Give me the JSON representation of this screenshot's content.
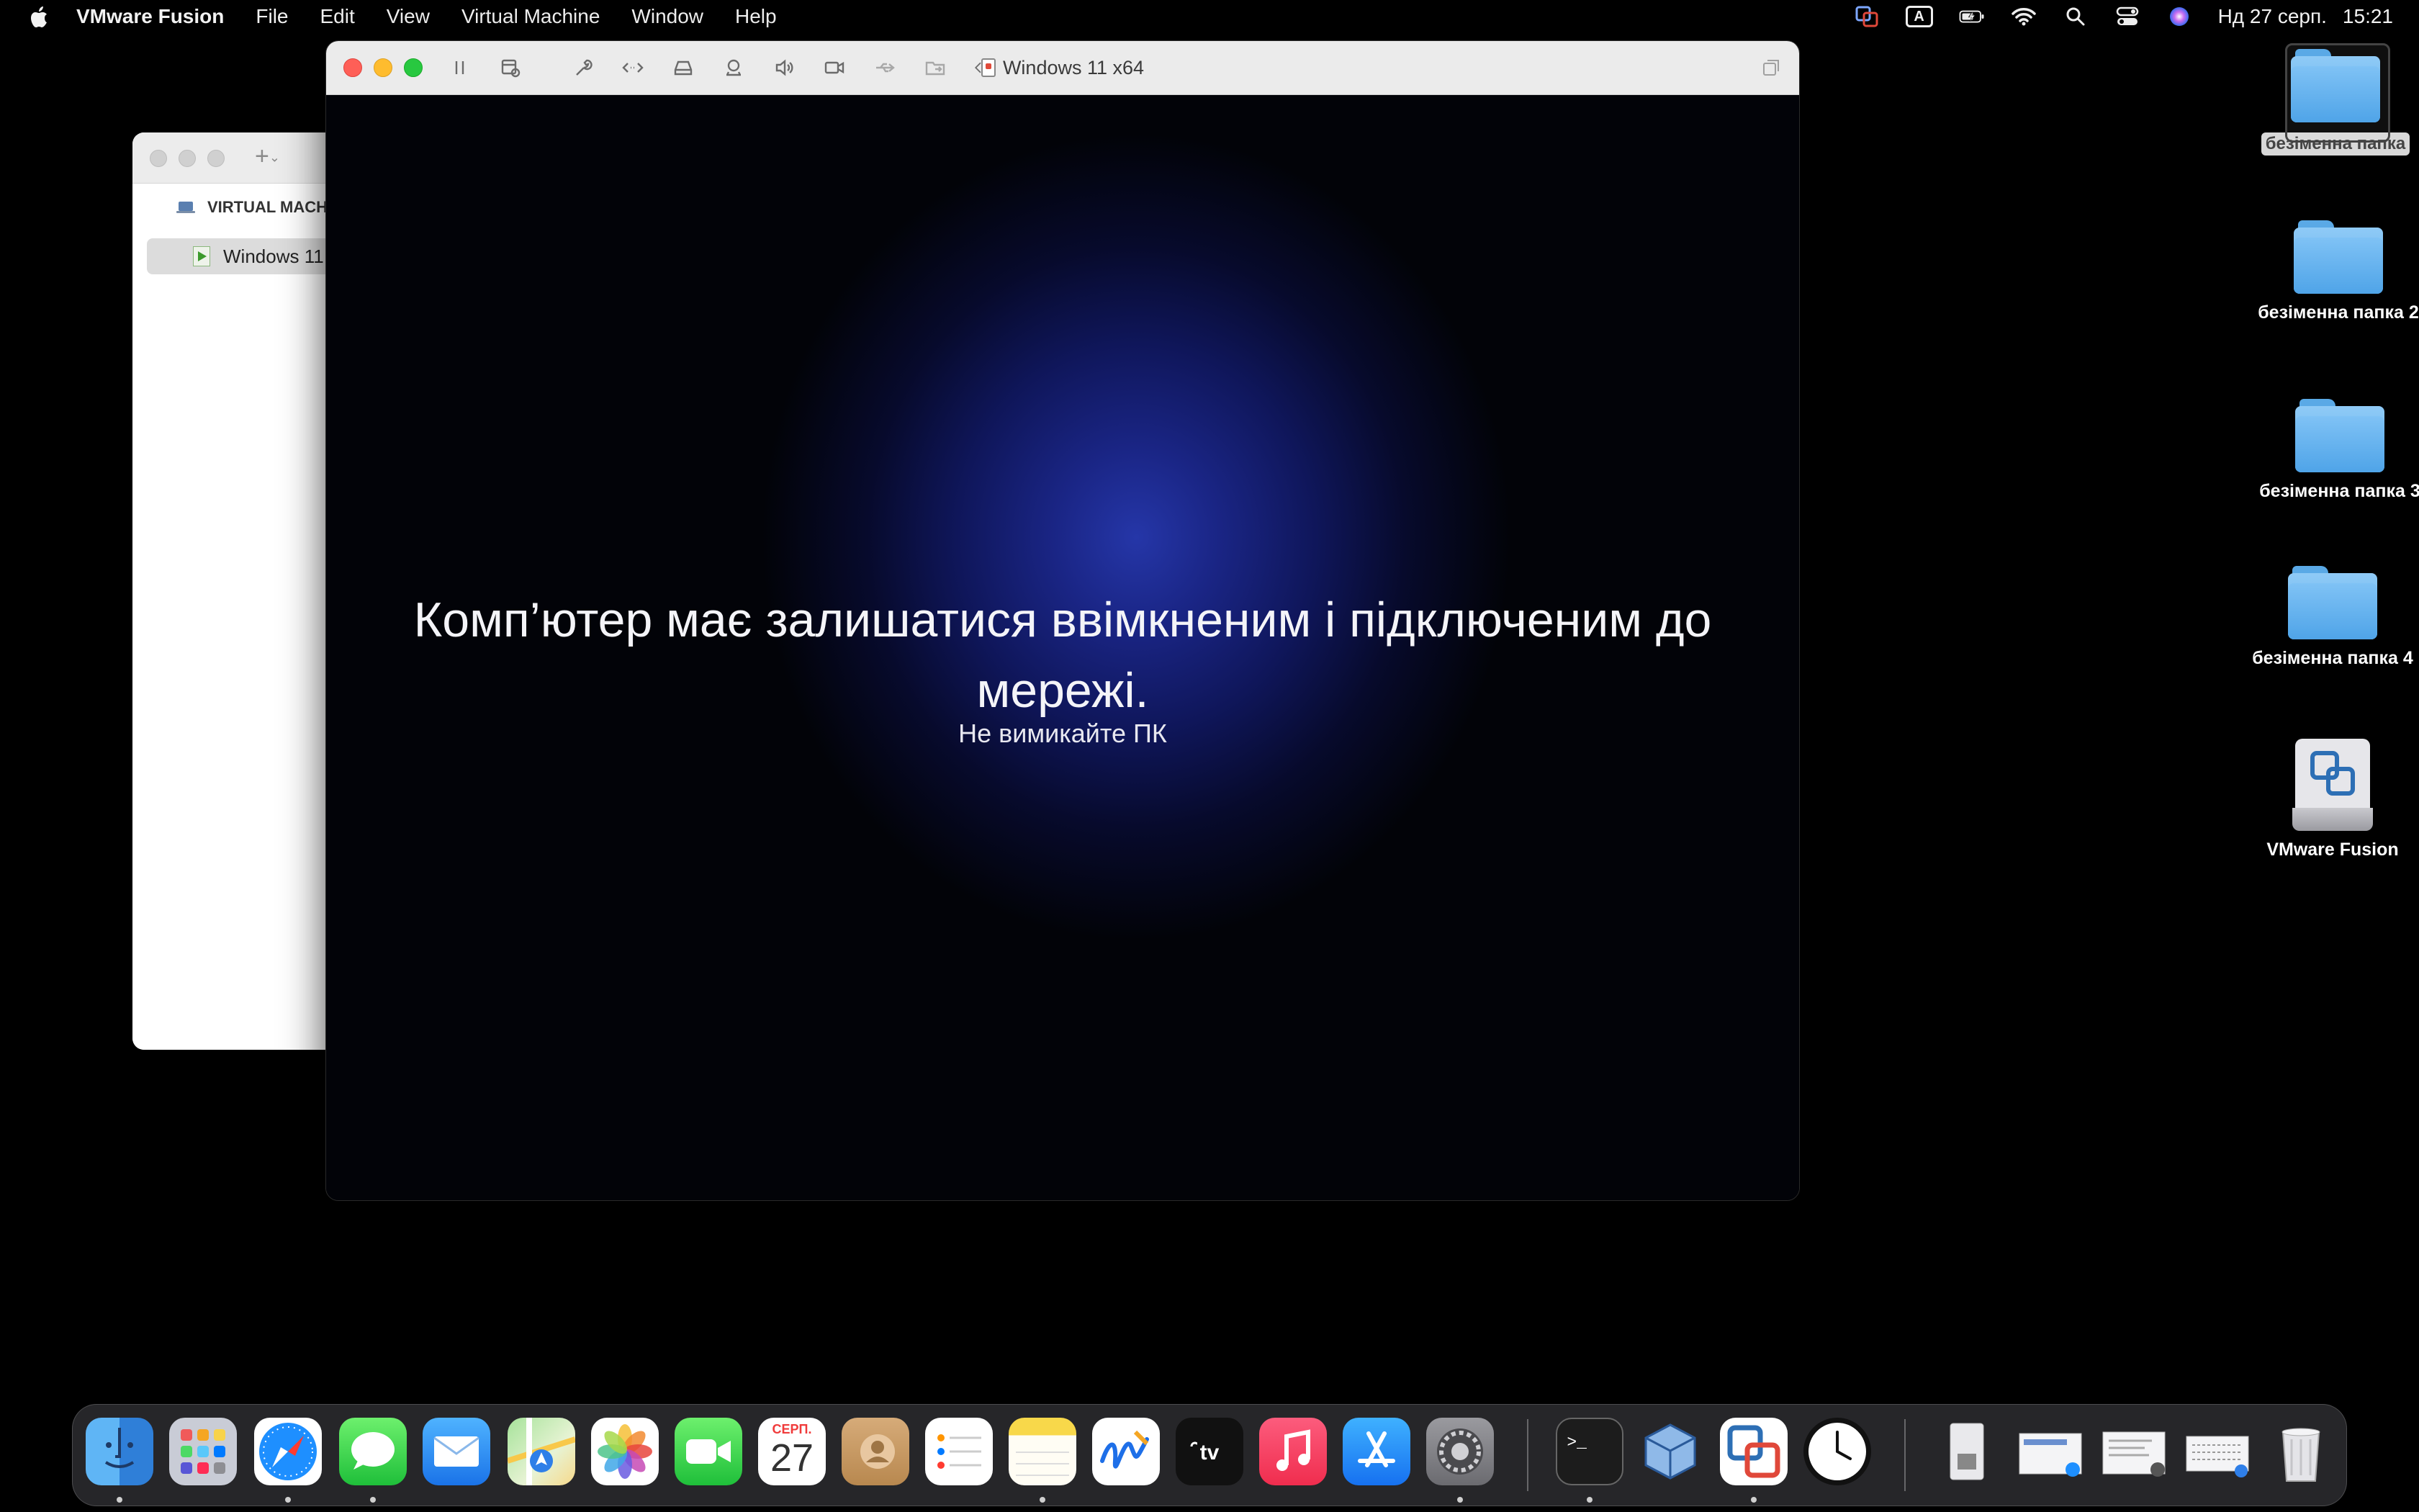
{
  "menubar": {
    "app_name": "VMware Fusion",
    "menus": [
      "File",
      "Edit",
      "View",
      "Virtual Machine",
      "Window",
      "Help"
    ],
    "input_source": "A",
    "date": "Нд 27 серп.",
    "time": "15:21"
  },
  "library": {
    "group_label": "VIRTUAL MACH",
    "vm_item": "Windows 11"
  },
  "vm_window": {
    "title": "Windows 11 x64",
    "screen": {
      "message": "Комп’ютер має залишатися ввімкненим і підключеним до мережі.",
      "submessage": "Не вимикайте ПК"
    }
  },
  "desktop": {
    "icons": [
      {
        "label": "безіменна папка",
        "kind": "folder",
        "selected": true
      },
      {
        "label": "безіменна папка 2",
        "kind": "folder"
      },
      {
        "label": "безіменна папка 3",
        "kind": "folder"
      },
      {
        "label": "безіменна папка 4",
        "kind": "folder"
      },
      {
        "label": "VMware Fusion",
        "kind": "drive"
      }
    ]
  },
  "dock": {
    "calendar_month": "СЕРП.",
    "calendar_day": "27",
    "apps": [
      "finder",
      "launchpad",
      "safari",
      "messages",
      "mail",
      "maps",
      "photos",
      "facetime",
      "calendar",
      "contacts",
      "reminders",
      "notes",
      "freeform",
      "tv",
      "music",
      "app-store",
      "system-settings",
      "terminal",
      "virtualbox",
      "vmware-fusion",
      "clock"
    ]
  },
  "colors": {
    "accent_red": "#fe5f57",
    "accent_yellow": "#febc2e",
    "accent_green": "#28c840",
    "folder_blue": "#5fb0ee",
    "screen_glow": "#2536a8"
  }
}
